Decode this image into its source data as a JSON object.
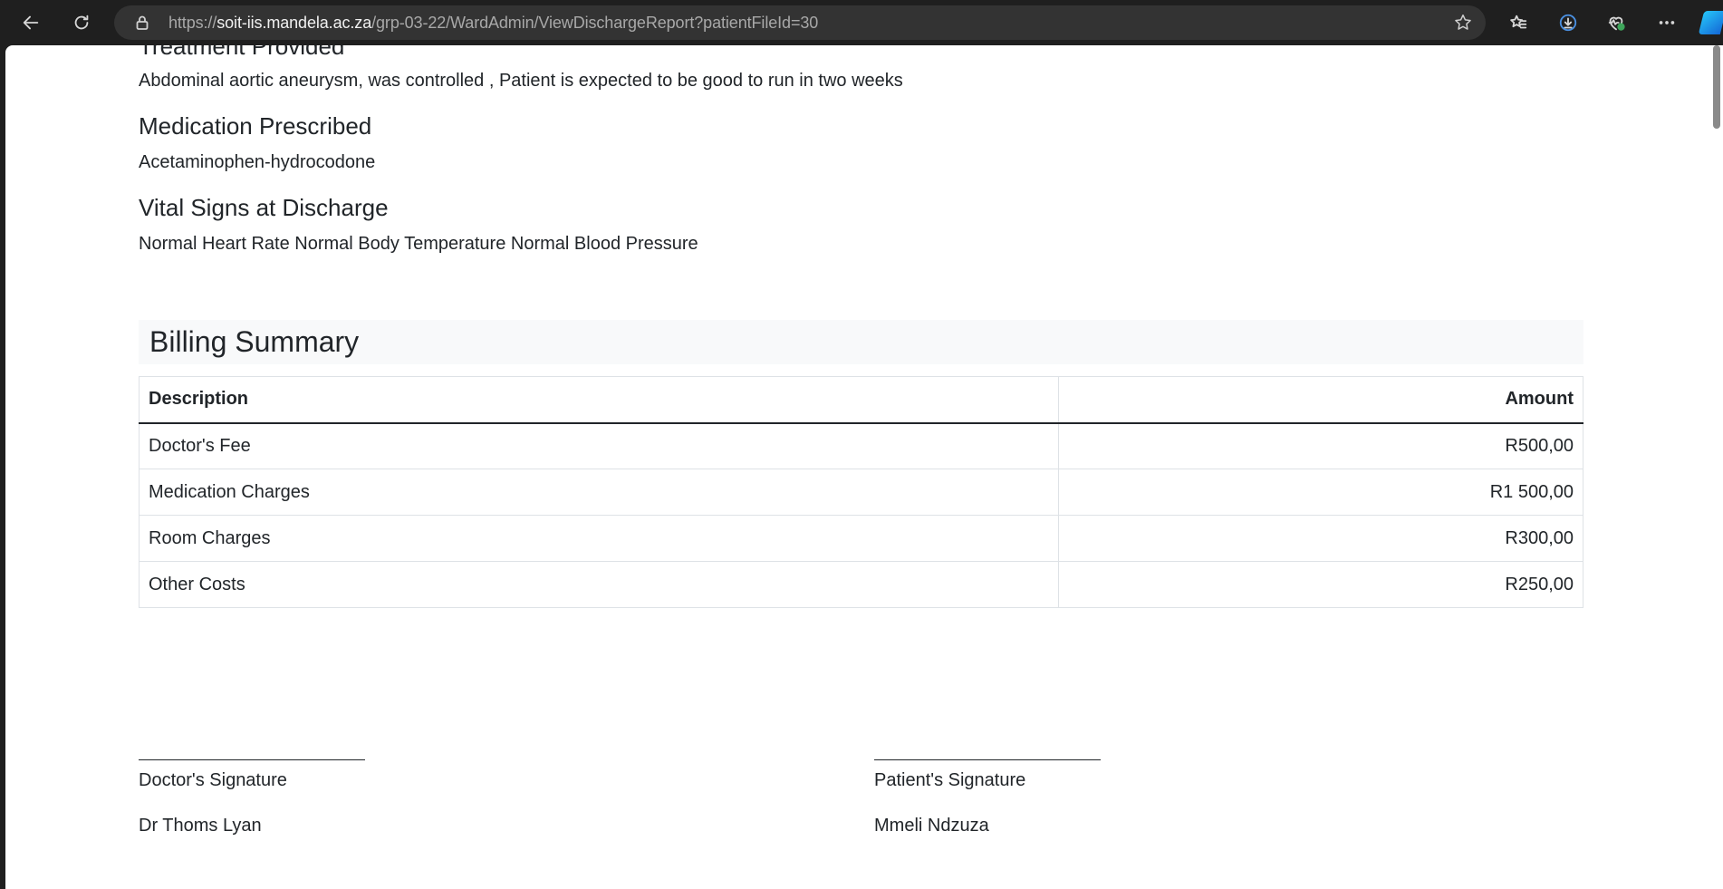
{
  "browser": {
    "url_prefix": "https://",
    "url_host": "soit-iis.mandela.ac.za",
    "url_path": "/grp-03-22/WardAdmin/ViewDischargeReport?patientFileId=30",
    "icons": [
      "back-icon",
      "refresh-icon",
      "lock-icon",
      "star-icon",
      "favorites-icon",
      "downloads-icon",
      "browser-essentials-icon",
      "more-icon",
      "copilot-icon"
    ]
  },
  "report": {
    "treatment_heading": "Treatment Provided",
    "treatment_text": "Abdominal aortic aneurysm, was controlled , Patient is expected to be good to run in two weeks",
    "medication_heading": "Medication Prescribed",
    "medication_text": "Acetaminophen-hydrocodone",
    "vitals_heading": "Vital Signs at Discharge",
    "vitals_text": "Normal Heart Rate Normal Body Temperature Normal Blood Pressure"
  },
  "billing": {
    "title": "Billing Summary",
    "columns": [
      "Description",
      "Amount"
    ],
    "rows": [
      {
        "description": "Doctor's Fee",
        "amount": "R500,00"
      },
      {
        "description": "Medication Charges",
        "amount": "R1 500,00"
      },
      {
        "description": "Room Charges",
        "amount": "R300,00"
      },
      {
        "description": "Other Costs",
        "amount": "R250,00"
      }
    ]
  },
  "signatures": {
    "doctor_label": "Doctor's Signature",
    "doctor_name": "Dr Thoms Lyan",
    "patient_label": "Patient's Signature",
    "patient_name": "Mmeli Ndzuza"
  }
}
